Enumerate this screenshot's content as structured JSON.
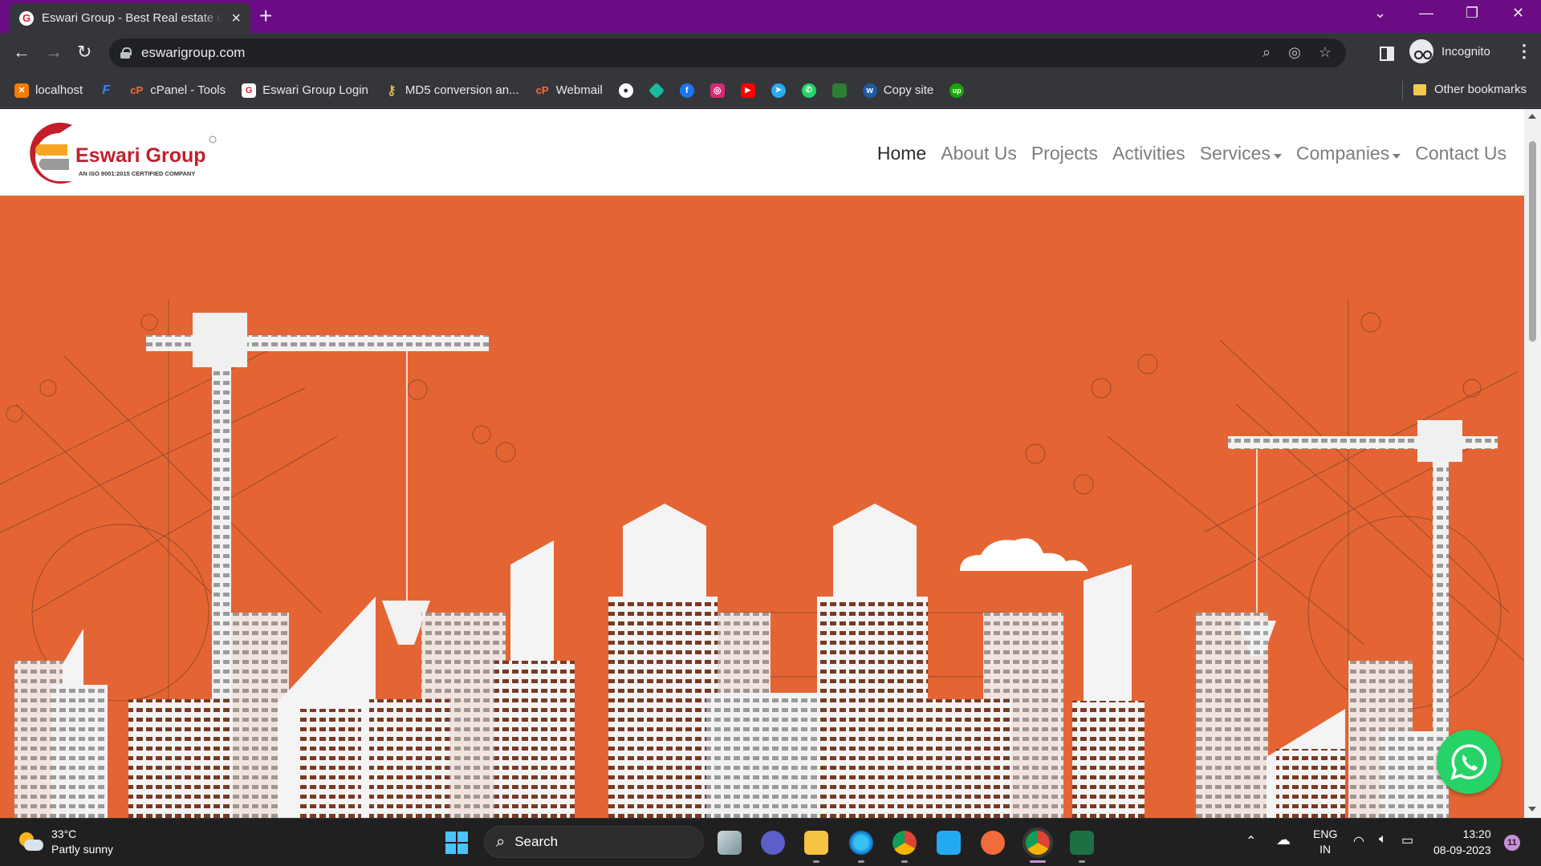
{
  "browser": {
    "tab_title": "Eswari Group - Best Real estate company",
    "url": "eswarigroup.com",
    "profile_label": "Incognito",
    "bookmarks": [
      {
        "label": "localhost",
        "icon": "xampp-icon",
        "color": "#f57c00"
      },
      {
        "label": "",
        "icon": "fasthosts-icon",
        "color": "#3b82f6"
      },
      {
        "label": "cPanel - Tools",
        "icon": "cpanel-icon",
        "color": "#ff6c2c"
      },
      {
        "label": "Eswari Group Login",
        "icon": "eswari-icon",
        "color": "#ffffff"
      },
      {
        "label": "MD5 conversion an...",
        "icon": "key-icon",
        "color": "#e0b64c"
      },
      {
        "label": "Webmail",
        "icon": "cpanel-icon",
        "color": "#ff6c2c"
      },
      {
        "label": "",
        "icon": "github-icon",
        "color": "#ffffff"
      },
      {
        "label": "",
        "icon": "diamond-icon",
        "color": "#1abc9c"
      },
      {
        "label": "",
        "icon": "facebook-icon",
        "color": "#1877f2"
      },
      {
        "label": "",
        "icon": "instagram-icon",
        "color": "#d62976"
      },
      {
        "label": "",
        "icon": "youtube-icon",
        "color": "#ff0000"
      },
      {
        "label": "",
        "icon": "telegram-icon",
        "color": "#2aabee"
      },
      {
        "label": "",
        "icon": "whatsapp-icon",
        "color": "#25d366"
      },
      {
        "label": "",
        "icon": "grass-icon",
        "color": "#2e7d32"
      },
      {
        "label": "Copy site",
        "icon": "w-icon",
        "color": "#1e5aa8"
      },
      {
        "label": "",
        "icon": "upwork-icon",
        "color": "#14a800"
      }
    ],
    "other_bookmarks": "Other bookmarks"
  },
  "site": {
    "logo_name": "Eswari Group",
    "logo_tagline": "AN ISO 9001:2015 CERTIFIED COMPANY",
    "nav": [
      {
        "label": "Home",
        "active": true,
        "dropdown": false
      },
      {
        "label": "About Us",
        "active": false,
        "dropdown": false
      },
      {
        "label": "Projects",
        "active": false,
        "dropdown": false
      },
      {
        "label": "Activities",
        "active": false,
        "dropdown": false
      },
      {
        "label": "Services",
        "active": false,
        "dropdown": true
      },
      {
        "label": "Companies",
        "active": false,
        "dropdown": true
      },
      {
        "label": "Contact Us",
        "active": false,
        "dropdown": false
      }
    ],
    "hero_color": "#e46533"
  },
  "taskbar": {
    "weather_temp": "33°C",
    "weather_desc": "Partly sunny",
    "search_label": "Search",
    "lang_top": "ENG",
    "lang_bottom": "IN",
    "time": "13:20",
    "date": "08-09-2023",
    "notifications": "11"
  }
}
